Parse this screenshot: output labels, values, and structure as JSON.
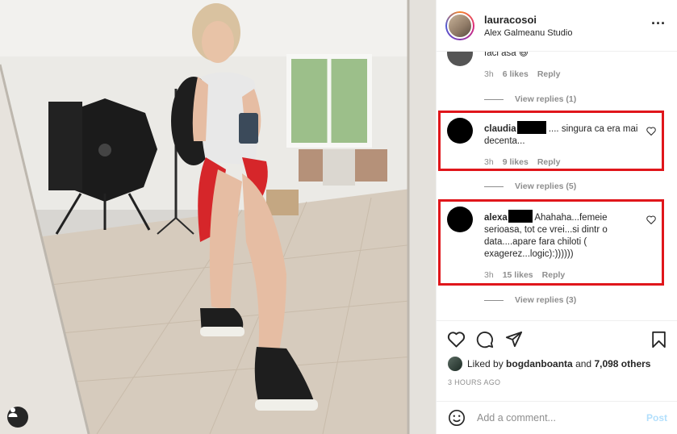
{
  "post": {
    "username": "lauracosoi",
    "location": "Alex Galmeanu Studio",
    "more_icon": "more-horizontal-icon"
  },
  "comments": {
    "partial": {
      "text": "faci asa 😆",
      "time": "3h",
      "likes": "6 likes",
      "reply": "Reply",
      "view_replies": "View replies (1)"
    },
    "items": [
      {
        "username": "claudia",
        "text": ".... singura ca era mai decenta...",
        "time": "3h",
        "likes": "9 likes",
        "reply": "Reply",
        "view_replies": "View replies (5)"
      },
      {
        "username": "alexa",
        "text": "Ahahaha...femeie serioasa, tot ce vrei...si dintr o data....apare fara chiloti ( exagerez...logic):))))))",
        "time": "3h",
        "likes": "15 likes",
        "reply": "Reply",
        "view_replies": "View replies (3)"
      }
    ]
  },
  "actions": {
    "icons": [
      "heart-icon",
      "comment-icon",
      "share-icon",
      "bookmark-icon"
    ],
    "liked_by_prefix": "Liked by",
    "liked_by_user": "bogdanboanta",
    "liked_by_and": "and",
    "liked_by_others": "7,098 others",
    "time_ago": "3 HOURS AGO"
  },
  "add_comment": {
    "placeholder": "Add a comment...",
    "post_label": "Post"
  },
  "colors": {
    "highlight_box": "#e0161b",
    "muted_text": "#8e8e8e",
    "post_disabled": "#b2dffc"
  }
}
